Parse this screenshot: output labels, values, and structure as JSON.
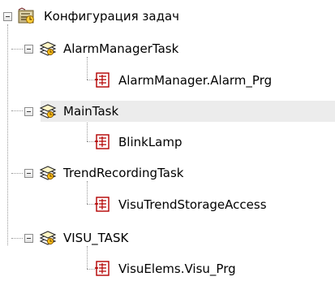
{
  "tree": {
    "root": {
      "label": "Конфигурация задач",
      "icon": "task-config-icon"
    },
    "tasks": [
      {
        "label": "AlarmManagerTask",
        "icon": "task-stack-icon",
        "expanded": true,
        "selected": false,
        "programs": [
          {
            "label": "AlarmManager.Alarm_Prg",
            "icon": "program-call-icon"
          }
        ]
      },
      {
        "label": "MainTask",
        "icon": "task-stack-icon",
        "expanded": true,
        "selected": true,
        "programs": [
          {
            "label": "BlinkLamp",
            "icon": "program-call-icon"
          }
        ]
      },
      {
        "label": "TrendRecordingTask",
        "icon": "task-stack-icon",
        "expanded": true,
        "selected": false,
        "programs": [
          {
            "label": "VisuTrendStorageAccess",
            "icon": "program-call-icon"
          }
        ]
      },
      {
        "label": "VISU_TASK",
        "icon": "task-stack-icon",
        "expanded": true,
        "selected": false,
        "programs": [
          {
            "label": "VisuElems.Visu_Prg",
            "icon": "program-call-icon"
          }
        ]
      }
    ]
  },
  "colors": {
    "selection_background": "#ececec",
    "tree_lines": "#9a9a9a",
    "program_icon": "#b30000"
  }
}
